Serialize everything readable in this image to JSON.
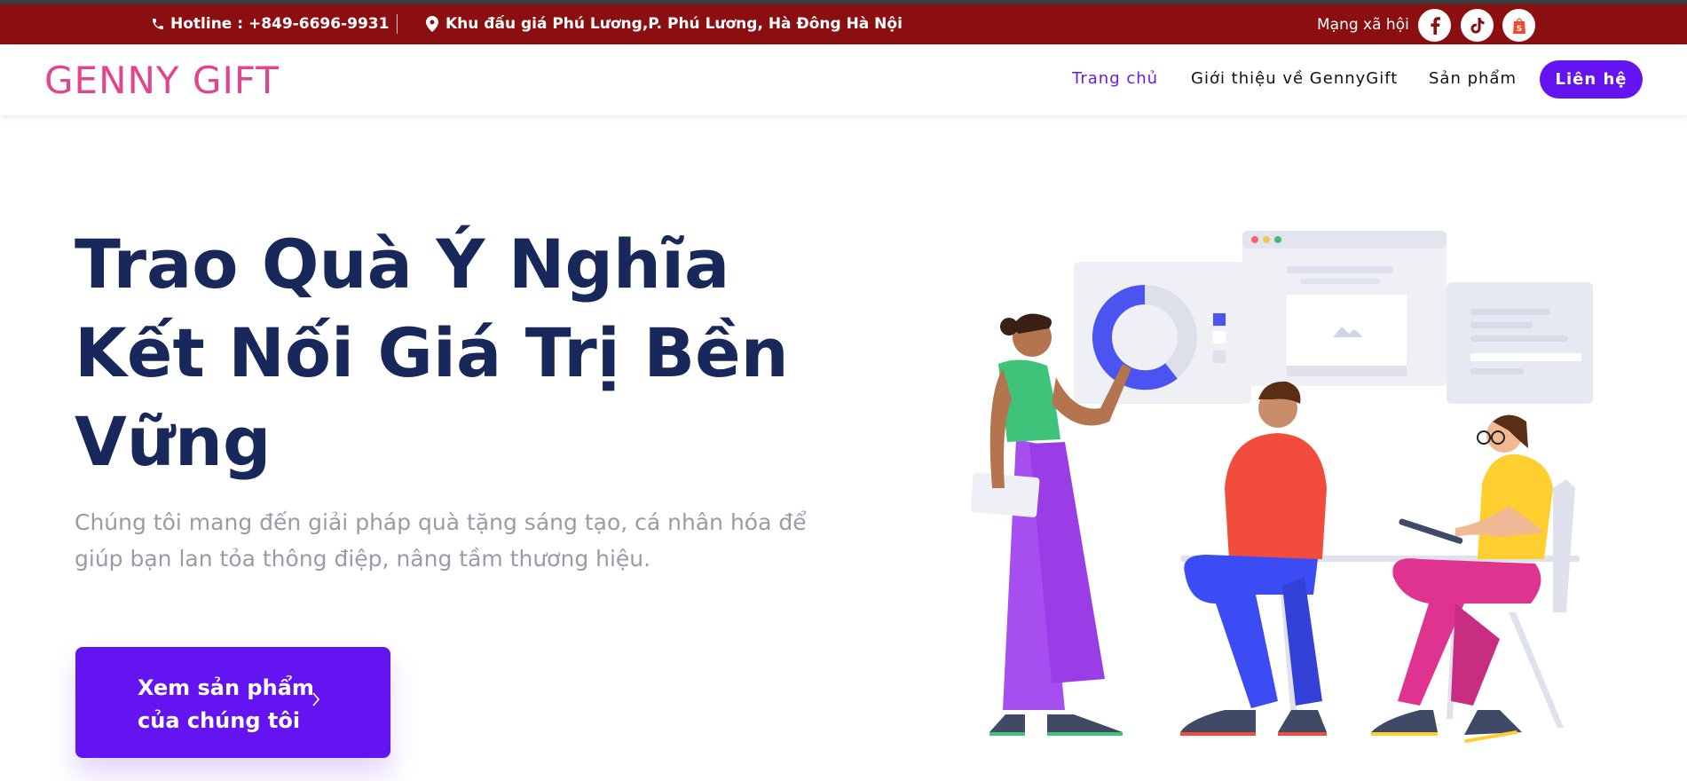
{
  "topbar": {
    "hotline": "Hotline : +849-6696-9931",
    "address": "Khu đấu giá Phú Lương,P. Phú Lương, Hà Đông Hà Nội",
    "social_label": "Mạng xã hội",
    "icons": [
      "phone-icon",
      "location-pin-icon",
      "facebook-icon",
      "tiktok-icon",
      "shopee-icon"
    ]
  },
  "header": {
    "logo": "GENNY GIFT",
    "nav": {
      "home": "Trang chủ",
      "about": "Giới thiệu về GennyGift",
      "products": "Sản phẩm",
      "contact": "Liên hệ"
    }
  },
  "hero": {
    "title_line1": "Trao Quà Ý Nghĩa",
    "title_line2": "Kết Nối Giá Trị Bền",
    "title_line3": "Vững",
    "subtitle_line1": "Chúng tôi mang đến giải pháp quà tặng sáng tạo, cá nhân hóa để",
    "subtitle_line2": "giúp bạn lan tỏa thông điệp, nâng tầm thương hiệu.",
    "cta_line1": "Xem sản phẩm",
    "cta_line2": "của chúng tôi"
  },
  "colors": {
    "topbar": "#8b0f10",
    "accent": "#6414f0",
    "logo": "#e0458e",
    "title": "#19285a"
  }
}
